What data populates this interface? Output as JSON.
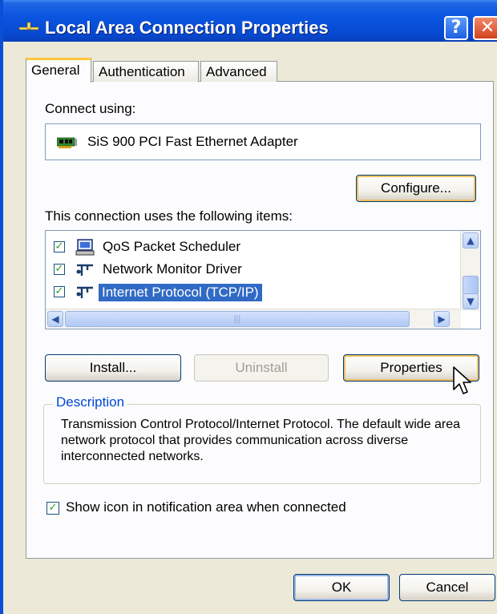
{
  "window": {
    "title": "Local Area Connection Properties",
    "help_label": "?",
    "close_label": "✕"
  },
  "tabs": [
    {
      "label": "General",
      "active": true
    },
    {
      "label": "Authentication",
      "active": false
    },
    {
      "label": "Advanced",
      "active": false
    }
  ],
  "connect_using": {
    "label": "Connect using:",
    "adapter_name": "SiS 900 PCI Fast Ethernet Adapter",
    "adapter_icon": "network-card-icon"
  },
  "buttons": {
    "configure": "Configure...",
    "install": "Install...",
    "uninstall": "Uninstall",
    "properties": "Properties",
    "ok": "OK",
    "cancel": "Cancel"
  },
  "items_label": "This connection uses the following items:",
  "items": [
    {
      "label": "QoS Packet Scheduler",
      "checked": true,
      "icon": "computer-icon",
      "selected": false
    },
    {
      "label": "Network Monitor Driver",
      "checked": true,
      "icon": "network-protocol-icon",
      "selected": false
    },
    {
      "label": "Internet Protocol (TCP/IP)",
      "checked": true,
      "icon": "network-protocol-icon",
      "selected": true
    }
  ],
  "description": {
    "title": "Description",
    "text": "Transmission Control Protocol/Internet Protocol. The default wide area network protocol that provides communication across diverse interconnected networks."
  },
  "notify": {
    "label": "Show icon in notification area when connected",
    "checked": true
  },
  "colors": {
    "titlebar": "#0a55e0",
    "selection": "#316ac5",
    "group_title": "#0046d5",
    "check": "#21a121"
  }
}
